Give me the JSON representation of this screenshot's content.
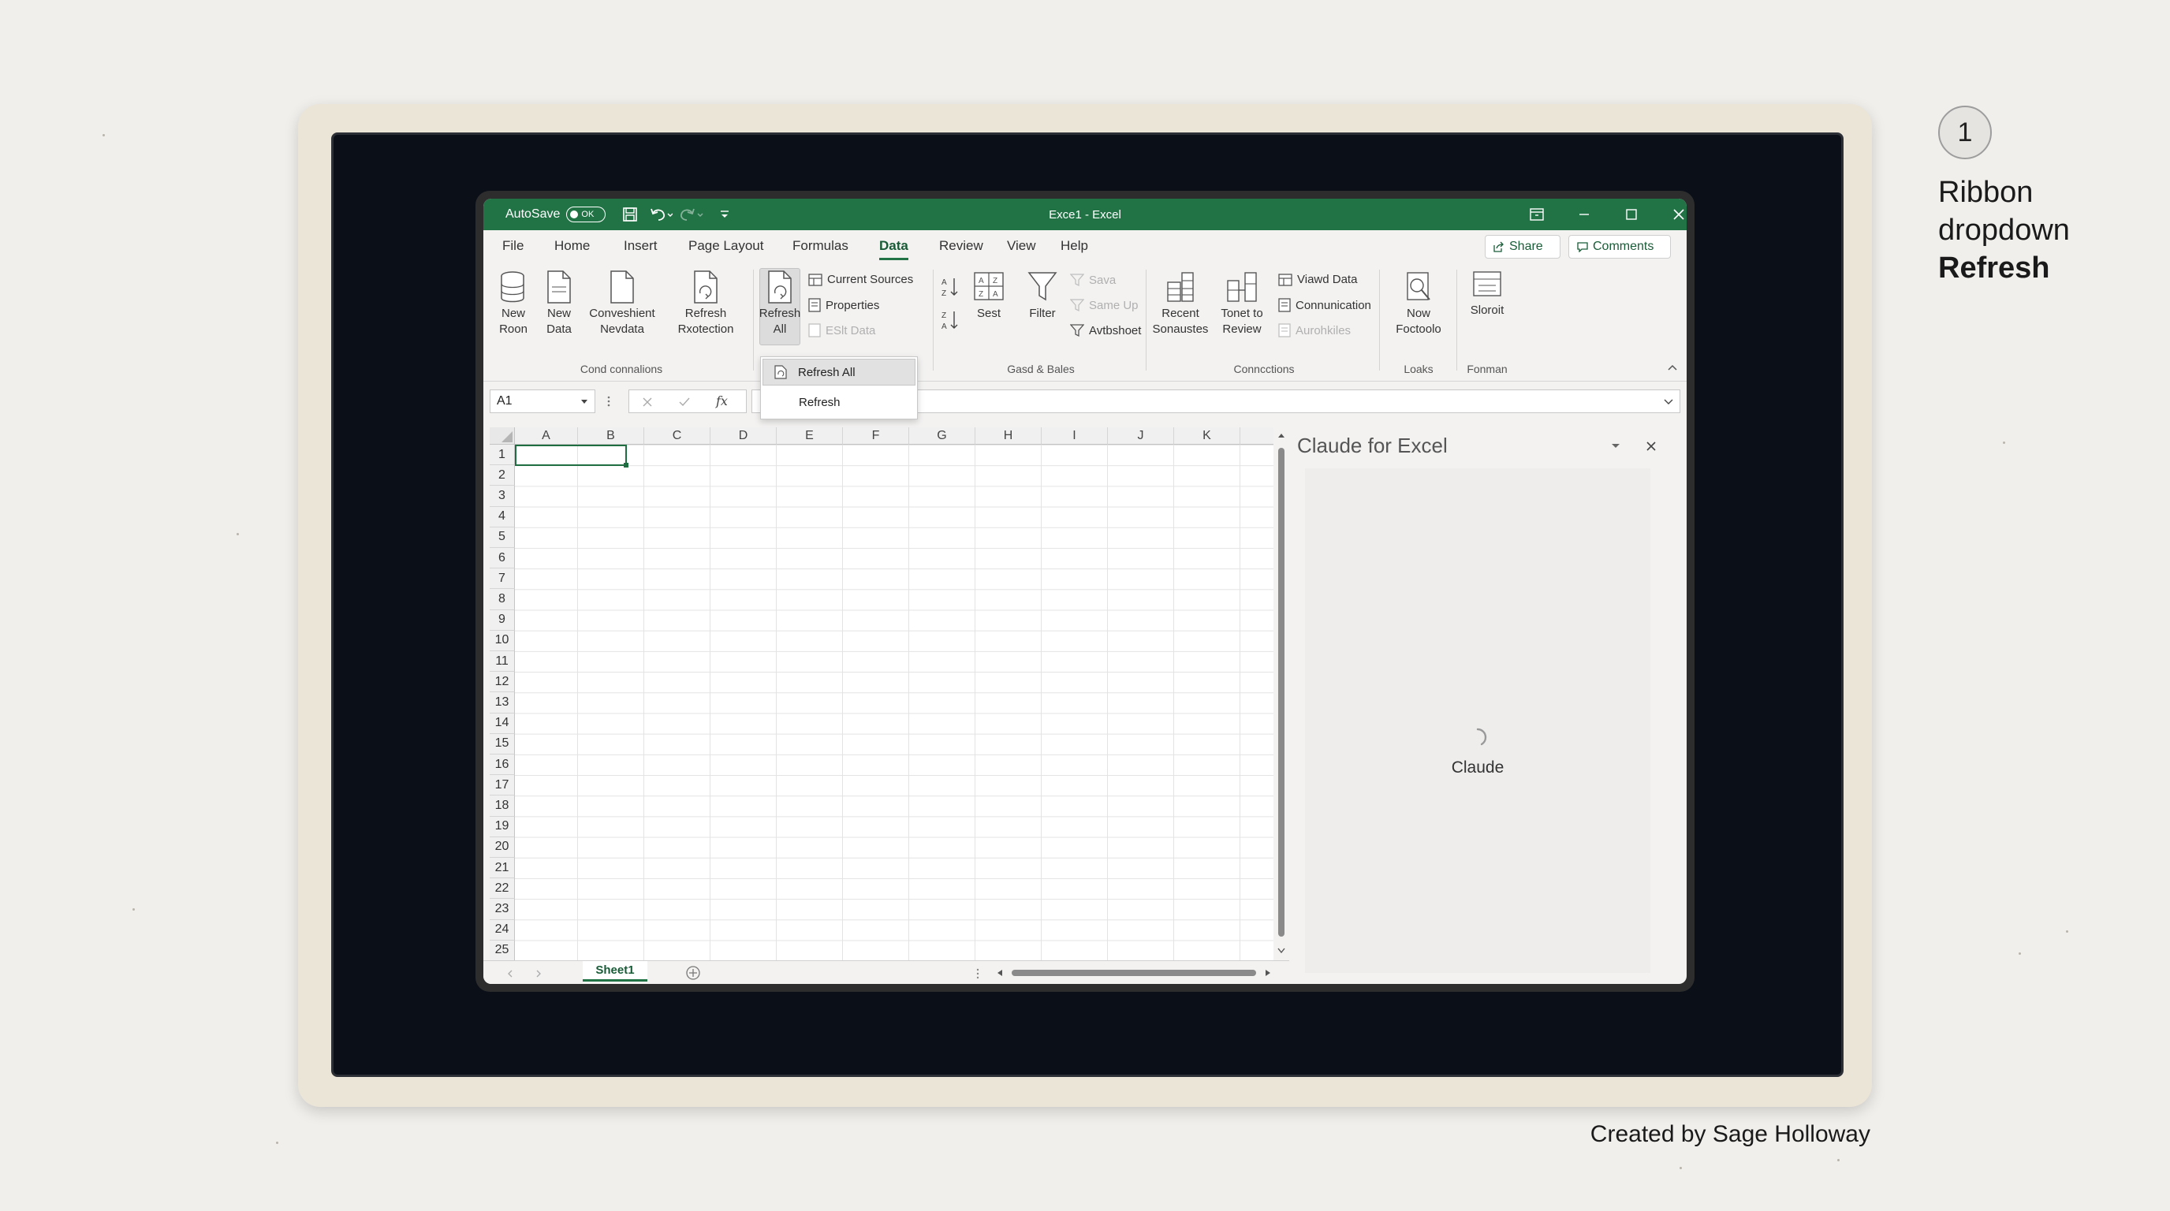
{
  "titlebar": {
    "autosave_label": "AutoSave",
    "autosave_state": "OK",
    "doc_title": "Exce1  -  Excel"
  },
  "menu": {
    "tabs": [
      "File",
      "Home",
      "Insert",
      "Page Layout",
      "Formulas",
      "Data",
      "Review",
      "View",
      "Help"
    ],
    "active_tab": "Data",
    "share_label": "Share",
    "comments_label": "Comments"
  },
  "ribbon": {
    "group1": {
      "label": "Cond connalions",
      "new_room": [
        "New",
        "Roon"
      ],
      "new_data": [
        "New",
        "Data"
      ],
      "convenient": [
        "Conveshient",
        "Nevdata"
      ],
      "refresh_rotection": [
        "Refresh",
        "Rxotection"
      ]
    },
    "refresh_all": [
      "Refresh",
      "All"
    ],
    "current_sources": "Current Sources",
    "properties": "Properties",
    "edit_data": "ESlt Data",
    "group2": {
      "label": "Gasd & Bales",
      "sest": "Sest",
      "filter": "Filter",
      "save": "Sava",
      "same_up": "Same Up",
      "avtbshoet": "Avtbshoet"
    },
    "group3": {
      "label": "Conncctions",
      "recent": [
        "Recent",
        "Sonaustes"
      ],
      "tonet": [
        "Tonet to",
        "Review"
      ],
      "viewd_data": "Viawd Data",
      "communication": "Connunication",
      "autofiles": "Aurohkiles"
    },
    "group4": {
      "label": "Loaks",
      "now": [
        "Now",
        "Foctoolo"
      ]
    },
    "group5": {
      "label": "Fonman",
      "sloroit": "Sloroit"
    }
  },
  "dropdown": {
    "items": [
      "Refresh All",
      "Refresh"
    ]
  },
  "formula_bar": {
    "name_box": "A1",
    "fx": "fx"
  },
  "grid": {
    "columns": [
      "A",
      "B",
      "C",
      "D",
      "E",
      "F",
      "G",
      "H",
      "I",
      "J",
      "K"
    ],
    "rows": [
      "1",
      "2",
      "3",
      "4",
      "5",
      "6",
      "7",
      "8",
      "9",
      "10",
      "11",
      "12",
      "13",
      "14",
      "15",
      "16",
      "17",
      "18",
      "19",
      "20",
      "21",
      "22",
      "23",
      "24",
      "25"
    ]
  },
  "sheets": {
    "active": "Sheet1"
  },
  "pane": {
    "title": "Claude for Excel",
    "loading_text": "Claude"
  },
  "annotation": {
    "step_number": "1",
    "line1": "Ribbon",
    "line2": "dropdown",
    "line3": "Refresh",
    "credit": "Created by Sage Holloway"
  },
  "colors": {
    "excel_green": "#217346",
    "accent_dark_green": "#185c37"
  }
}
